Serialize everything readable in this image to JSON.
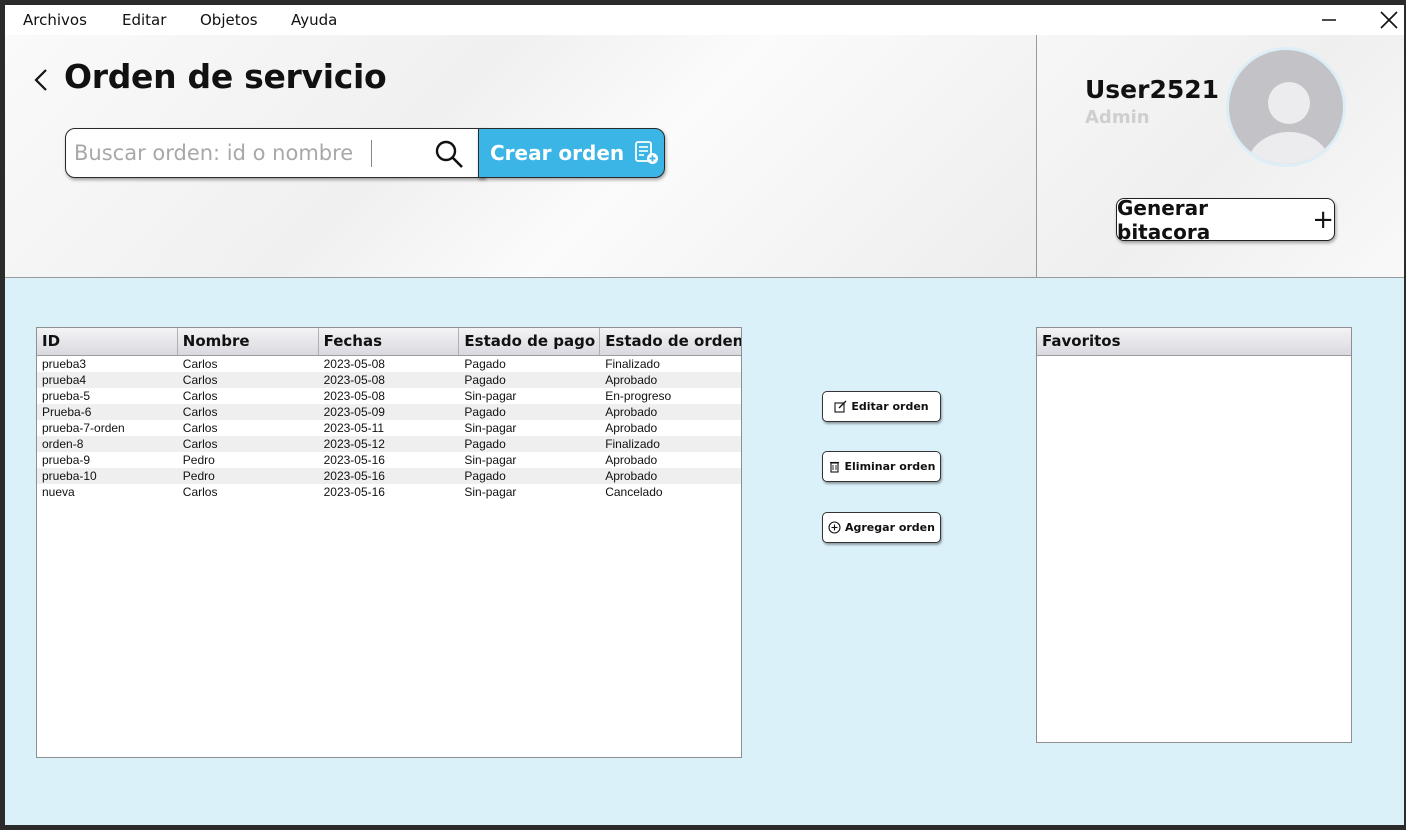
{
  "menu": {
    "items": [
      "Archivos",
      "Editar",
      "Objetos",
      "Ayuda"
    ]
  },
  "header": {
    "title": "Orden de servicio",
    "search": {
      "placeholder": "Buscar orden: id o nombre",
      "value": ""
    },
    "create_label": "Crear orden"
  },
  "user": {
    "name": "User2521",
    "role": "Admin",
    "bitacora_label": "Generar bitacora"
  },
  "table": {
    "columns": [
      "ID",
      "Nombre",
      "Fechas",
      "Estado de pago",
      "Estado de orden"
    ],
    "rows": [
      [
        "prueba3",
        "Carlos",
        "2023-05-08",
        "Pagado",
        "Finalizado"
      ],
      [
        "prueba4",
        "Carlos",
        "2023-05-08",
        "Pagado",
        "Aprobado"
      ],
      [
        "prueba-5",
        "Carlos",
        "2023-05-08",
        "Sin-pagar",
        "En-progreso"
      ],
      [
        "Prueba-6",
        "Carlos",
        "2023-05-09",
        "Pagado",
        "Aprobado"
      ],
      [
        "prueba-7-orden",
        "Carlos",
        "2023-05-11",
        "Sin-pagar",
        "Aprobado"
      ],
      [
        "orden-8",
        "Carlos",
        "2023-05-12",
        "Pagado",
        "Finalizado"
      ],
      [
        "prueba-9",
        "Pedro",
        "2023-05-16",
        "Sin-pagar",
        "Aprobado"
      ],
      [
        "prueba-10",
        "Pedro",
        "2023-05-16",
        "Pagado",
        "Aprobado"
      ],
      [
        "nueva",
        "Carlos",
        "2023-05-16",
        "Sin-pagar",
        "Cancelado"
      ]
    ]
  },
  "actions": {
    "edit_label": "Editar orden",
    "delete_label": "Eliminar orden",
    "add_label": "Agregar orden"
  },
  "favorites": {
    "title": "Favoritos",
    "items": []
  },
  "colors": {
    "accent": "#3ab5e6",
    "content_bg": "#dbf1fa"
  }
}
